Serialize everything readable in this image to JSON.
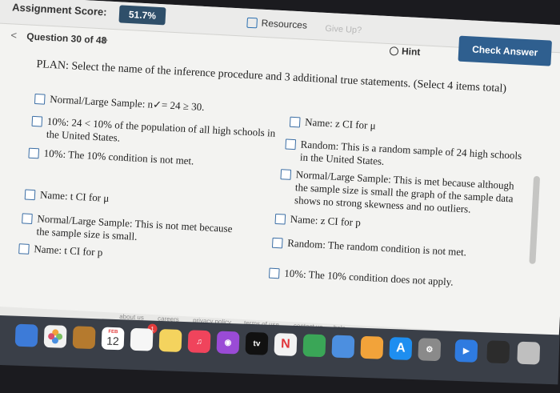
{
  "header": {
    "score_label": "Assignment Score:",
    "score_value": "51.7%",
    "resources_label": "Resources",
    "giveup_label": "Give Up?",
    "hint_label": "Hint",
    "check_answer_label": "Check Answer"
  },
  "question": {
    "number_label": "Question 30 of 48",
    "plan": "PLAN: Select the name of the inference procedure and 3 additional true statements. (Select 4 items total)"
  },
  "options_left": [
    {
      "text": "Normal/Large Sample: n✓= 24 ≥ 30."
    },
    {
      "text": "10%: 24 < 10% of the population of all high schools in the United States."
    },
    {
      "text": "10%: The 10% condition is not met."
    },
    {
      "text": "Name: t CI for μ"
    },
    {
      "text": "Normal/Large Sample: This is not met because the sample size is small."
    },
    {
      "text": "Name: t CI for p"
    }
  ],
  "options_right": [
    {
      "text": "Name: z CI for μ"
    },
    {
      "text": "Random: This is a random sample of 24 high schools in the United States."
    },
    {
      "text": "Normal/Large Sample: This is met because although the sample size is small the graph of the sample data shows no strong skewness and no outliers."
    },
    {
      "text": "Name: z CI for p"
    },
    {
      "text": "Random: The random condition is not met."
    },
    {
      "text": "10%: The 10% condition does not apply."
    }
  ],
  "footer": {
    "links": [
      "about us",
      "careers",
      "privacy policy",
      "terms of use",
      "contact us",
      "help"
    ]
  },
  "dock": {
    "calendar_month": "FEB",
    "calendar_day": "12",
    "notification_count": "1",
    "tv_label": "tv"
  }
}
